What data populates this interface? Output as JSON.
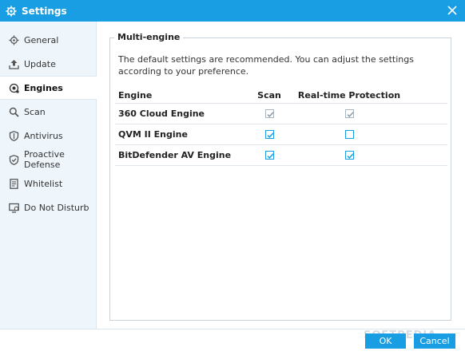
{
  "window": {
    "title": "Settings"
  },
  "sidebar": {
    "items": [
      {
        "label": "General",
        "icon": "gear-icon",
        "active": false
      },
      {
        "label": "Update",
        "icon": "upload-icon",
        "active": false
      },
      {
        "label": "Engines",
        "icon": "engine-icon",
        "active": true
      },
      {
        "label": "Scan",
        "icon": "magnifier-icon",
        "active": false
      },
      {
        "label": "Antivirus",
        "icon": "shield-icon",
        "active": false
      },
      {
        "label": "Proactive Defense",
        "icon": "shield-check-icon",
        "active": false
      },
      {
        "label": "Whitelist",
        "icon": "document-icon",
        "active": false
      },
      {
        "label": "Do Not Disturb",
        "icon": "monitor-icon",
        "active": false
      }
    ]
  },
  "main": {
    "group_title": "Multi-engine",
    "description": "The default settings are recommended. You can adjust the settings according to your preference.",
    "table": {
      "headers": {
        "engine": "Engine",
        "scan": "Scan",
        "realtime": "Real-time Protection"
      },
      "rows": [
        {
          "engine": "360 Cloud Engine",
          "scan": true,
          "scan_locked": true,
          "realtime": true,
          "realtime_locked": true
        },
        {
          "engine": "QVM II Engine",
          "scan": true,
          "scan_locked": false,
          "realtime": false,
          "realtime_locked": false
        },
        {
          "engine": "BitDefender AV Engine",
          "scan": true,
          "scan_locked": false,
          "realtime": true,
          "realtime_locked": false
        }
      ]
    }
  },
  "footer": {
    "ok_label": "OK",
    "cancel_label": "Cancel",
    "watermark": "SOFTPEDIA"
  },
  "colors": {
    "accent": "#1a9ee3",
    "sidebar_bg": "#eef6fc",
    "locked_check": "#8a99a6"
  }
}
